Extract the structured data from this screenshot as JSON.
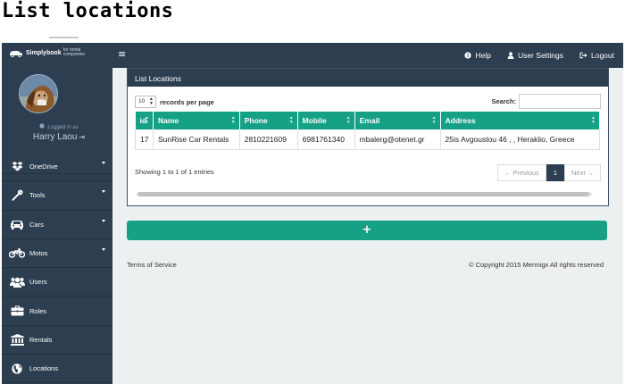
{
  "page_heading": "List locations",
  "topbar": {
    "brand_name": "Simplybook",
    "brand_sub": "for rental companies",
    "hamburger_glyph": "≡",
    "help_label": "Help",
    "user_settings_label": "User Settings",
    "logout_label": "Logout"
  },
  "sidebar": {
    "logged_in_as": "Logged in as",
    "user_name": "Harry Laou",
    "logout_glyph": "⇥",
    "items": [
      {
        "label": "OneDrive",
        "icon": "dropbox-icon",
        "has_caret": true
      },
      {
        "label": "Tools",
        "icon": "wrench-icon",
        "has_caret": true
      },
      {
        "label": "Cars",
        "icon": "car-icon",
        "has_caret": true
      },
      {
        "label": "Motos",
        "icon": "motorcycle-icon",
        "has_caret": true
      },
      {
        "label": "Users",
        "icon": "users-icon",
        "has_caret": false
      },
      {
        "label": "Roles",
        "icon": "briefcase-icon",
        "has_caret": false
      },
      {
        "label": "Rentals",
        "icon": "bank-icon",
        "has_caret": false
      },
      {
        "label": "Locations",
        "icon": "globe-icon",
        "has_caret": false
      }
    ]
  },
  "panel": {
    "title": "List Locations",
    "length_value": "10",
    "records_label": "records per page",
    "search_label": "Search:",
    "search_value": "",
    "columns": [
      "id",
      "Name",
      "Phone",
      "Mobile",
      "Email",
      "Address"
    ],
    "rows": [
      [
        "17",
        "SunRise Car Rentals",
        "2810221609",
        "6981761340",
        "mbalerg@otenet.gr",
        "25is Avgoustou 46 , , Heraklio, Greece"
      ]
    ],
    "info": "Showing 1 to 1 of 1 entries",
    "pager": {
      "previous": "← Previous",
      "page": "1",
      "next": "Next →"
    }
  },
  "add_button_label": "+",
  "footer": {
    "terms": "Terms of Service",
    "copyright": "© Copyright 2015 Mermigx All rights reserved"
  },
  "colors": {
    "navy": "#2c3e50",
    "teal": "#16a085",
    "content_bg": "#ecf0f1"
  }
}
